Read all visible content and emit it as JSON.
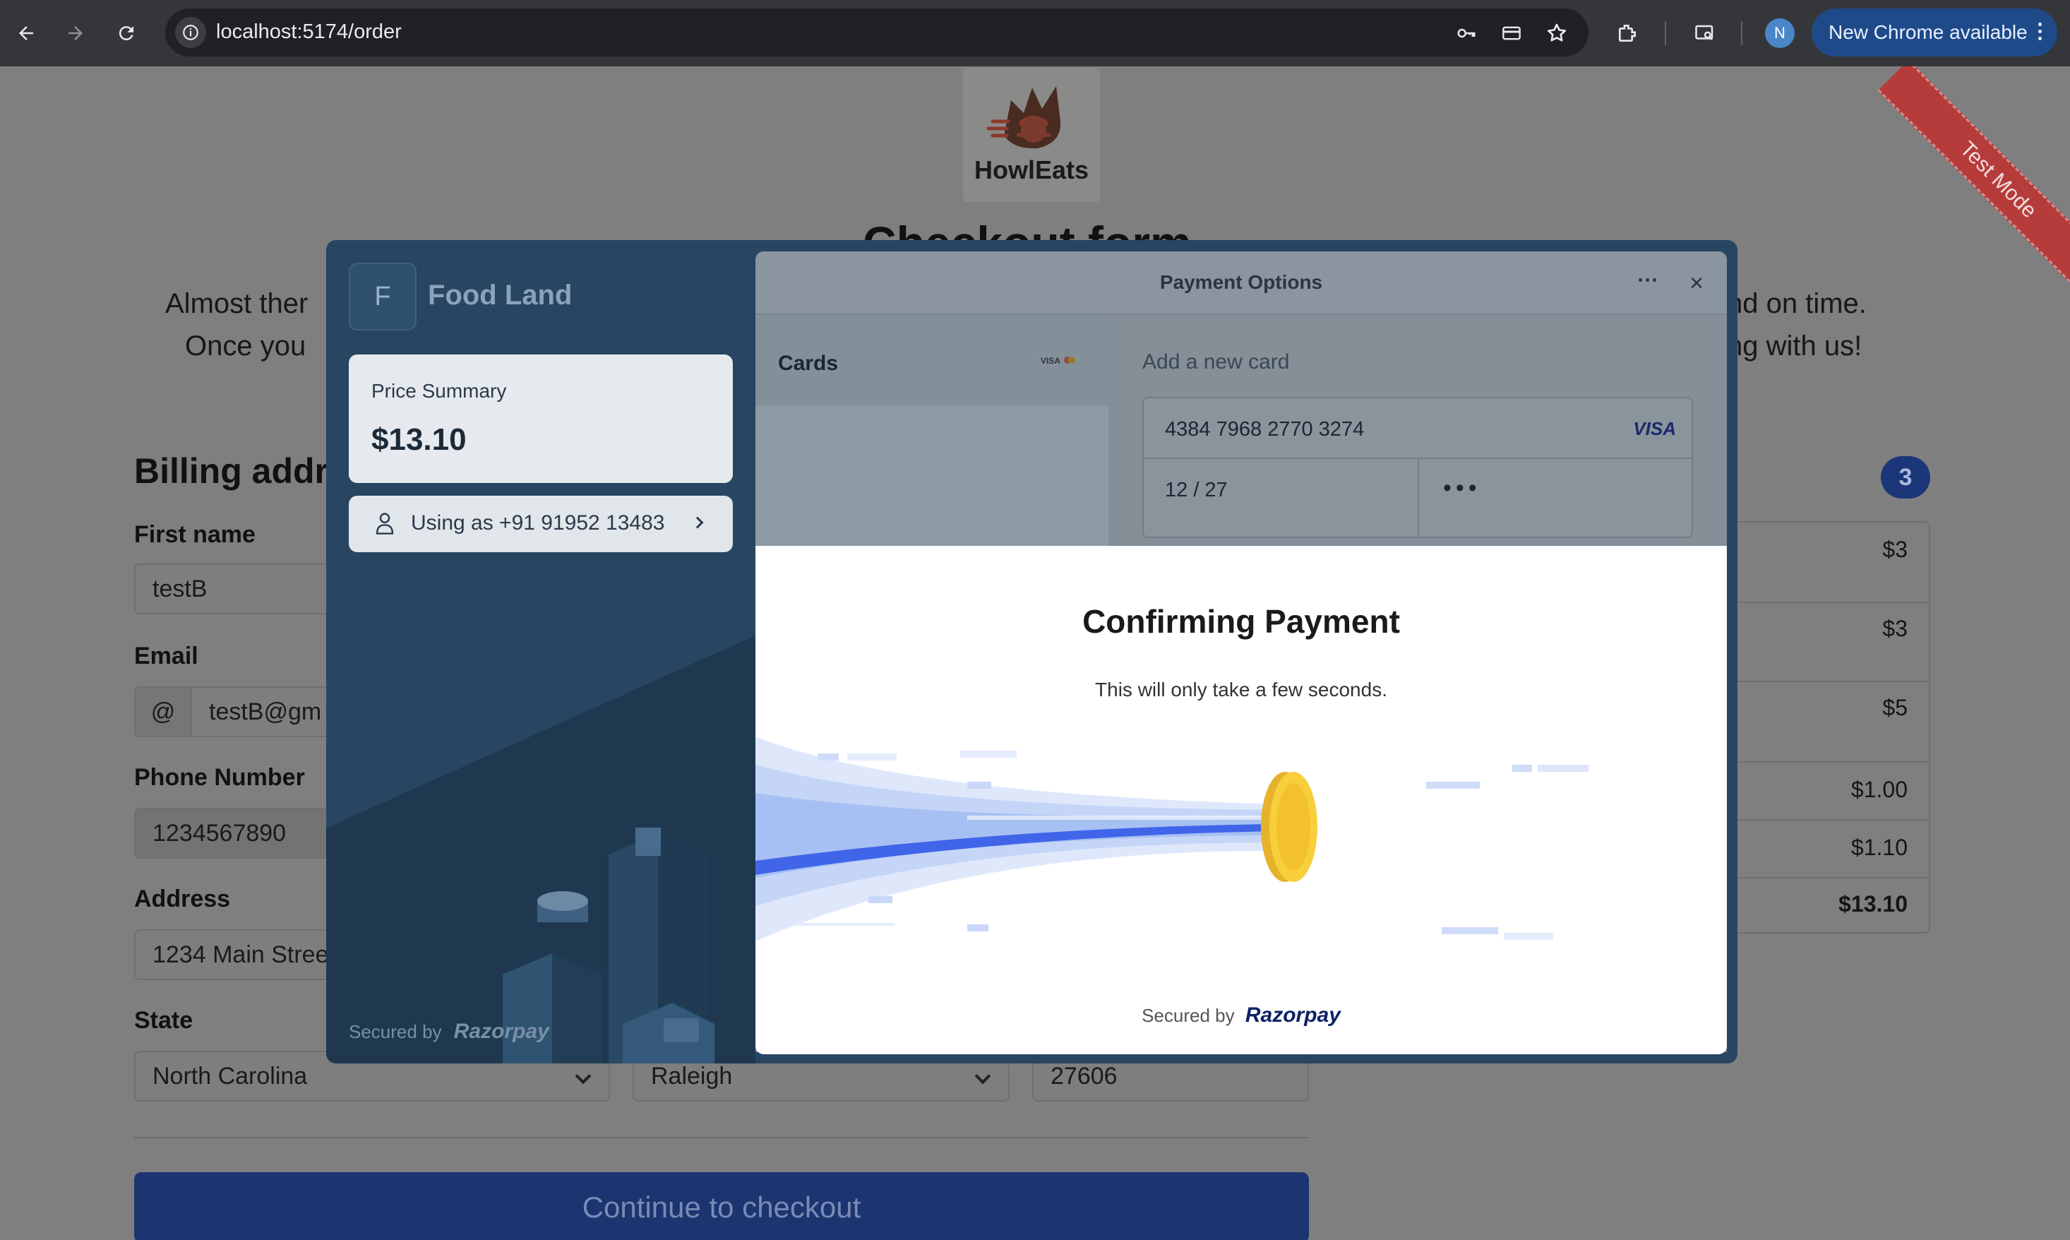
{
  "browser": {
    "url": "localhost:5174/order",
    "profile_initial": "N",
    "update_label": "New Chrome available"
  },
  "page": {
    "brand": "HowlEats",
    "heading": "Checkout form",
    "lead_left_1": "Almost ther",
    "lead_left_2": "Once you",
    "lead_right_1": "nd on time.",
    "lead_right_2": "ng with us!",
    "billing_title": "Billing addr",
    "labels": {
      "first_name": "First name",
      "email": "Email",
      "phone": "Phone Number",
      "address": "Address",
      "state": "State"
    },
    "values": {
      "first_name": "testB",
      "email_prefix": "@",
      "email": "testB@gm",
      "phone": "1234567890",
      "address": "1234 Main Stree",
      "state": "North Carolina",
      "city": "Raleigh",
      "zip": "27606"
    },
    "checkout_button": "Continue to checkout",
    "cart": {
      "count": "3",
      "rows": [
        "$3",
        "$3",
        "$5",
        "$1.00",
        "$1.10",
        "$13.10"
      ]
    },
    "test_mode": "Test Mode"
  },
  "razorpay": {
    "merchant_initial": "F",
    "merchant_name": "Food Land",
    "price_label": "Price Summary",
    "price": "$13.10",
    "user_label": "Using as +91 91952 13483",
    "secured_by": "Secured by",
    "brand": "Razorpay",
    "header_title": "Payment Options",
    "method_cards": "Cards",
    "add_card": "Add a new card",
    "card_number": "4384 7968 2770 3274",
    "card_brand": "VISA",
    "card_expiry": "12 / 27",
    "card_cvv": "•••"
  },
  "confirm": {
    "title": "Confirming Payment",
    "subtitle": "This will only take a few seconds.",
    "secured_by": "Secured by",
    "brand": "Razorpay"
  }
}
